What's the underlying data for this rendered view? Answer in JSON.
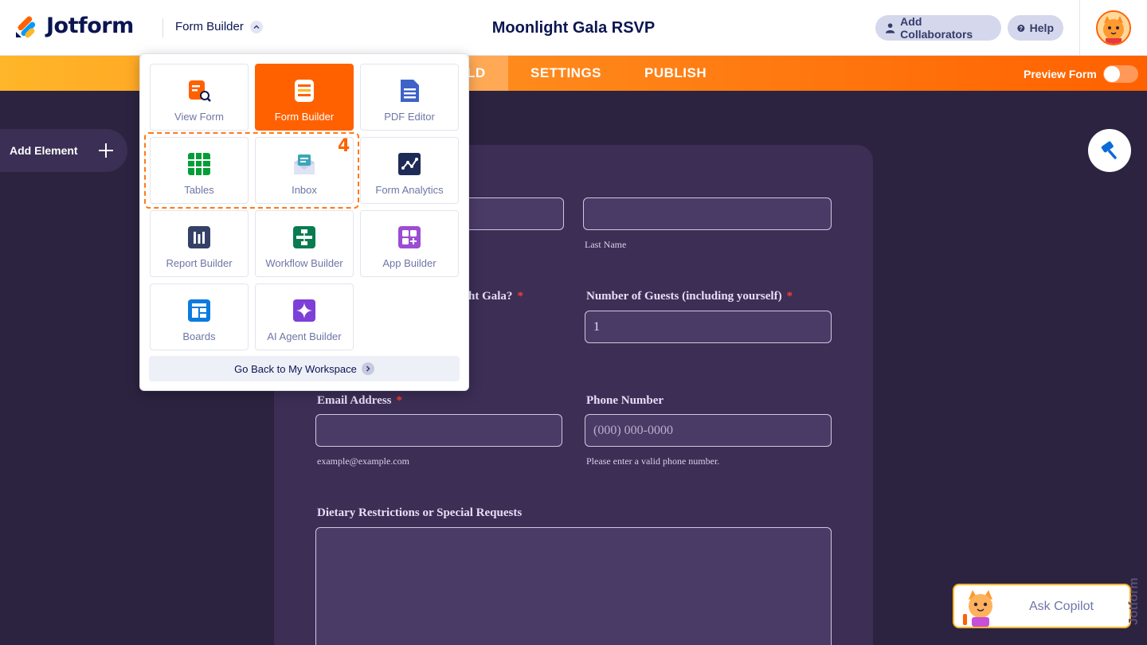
{
  "header": {
    "brand": "Jotform",
    "builder_switch": "Form Builder",
    "form_title": "Moonlight Gala RSVP",
    "collaborators_label": "Add Collaborators",
    "help_label": "Help"
  },
  "nav": {
    "tabs": [
      "BUILD",
      "SETTINGS",
      "PUBLISH"
    ],
    "build_visible": "LD",
    "preview_label": "Preview Form"
  },
  "sidebar": {
    "add_element_label": "Add Element"
  },
  "dropdown": {
    "tiles": [
      {
        "label": "View Form"
      },
      {
        "label": "Form Builder",
        "active": true
      },
      {
        "label": "PDF Editor"
      },
      {
        "label": "Tables"
      },
      {
        "label": "Inbox"
      },
      {
        "label": "Form Analytics"
      },
      {
        "label": "Report Builder"
      },
      {
        "label": "Workflow Builder"
      },
      {
        "label": "App Builder"
      },
      {
        "label": "Boards"
      },
      {
        "label": "AI Agent Builder"
      }
    ],
    "step_number": "4",
    "back_label": "Go Back to My Workspace"
  },
  "form": {
    "last_name_sublabel": "Last Name",
    "attend_label_partial": "ht Gala?",
    "guests_label": "Number of Guests (including yourself)",
    "guests_value": "1",
    "email_label": "Email Address",
    "email_sublabel": "example@example.com",
    "phone_label": "Phone Number",
    "phone_placeholder": "(000) 000-0000",
    "phone_sublabel": "Please enter a valid phone number.",
    "dietary_label": "Dietary Restrictions or Special Requests",
    "required_mark": "*"
  },
  "copilot": {
    "label": "Ask Copilot"
  },
  "colors": {
    "accent": "#ff6100",
    "navy": "#0a1551",
    "canvas": "#2c2340"
  }
}
